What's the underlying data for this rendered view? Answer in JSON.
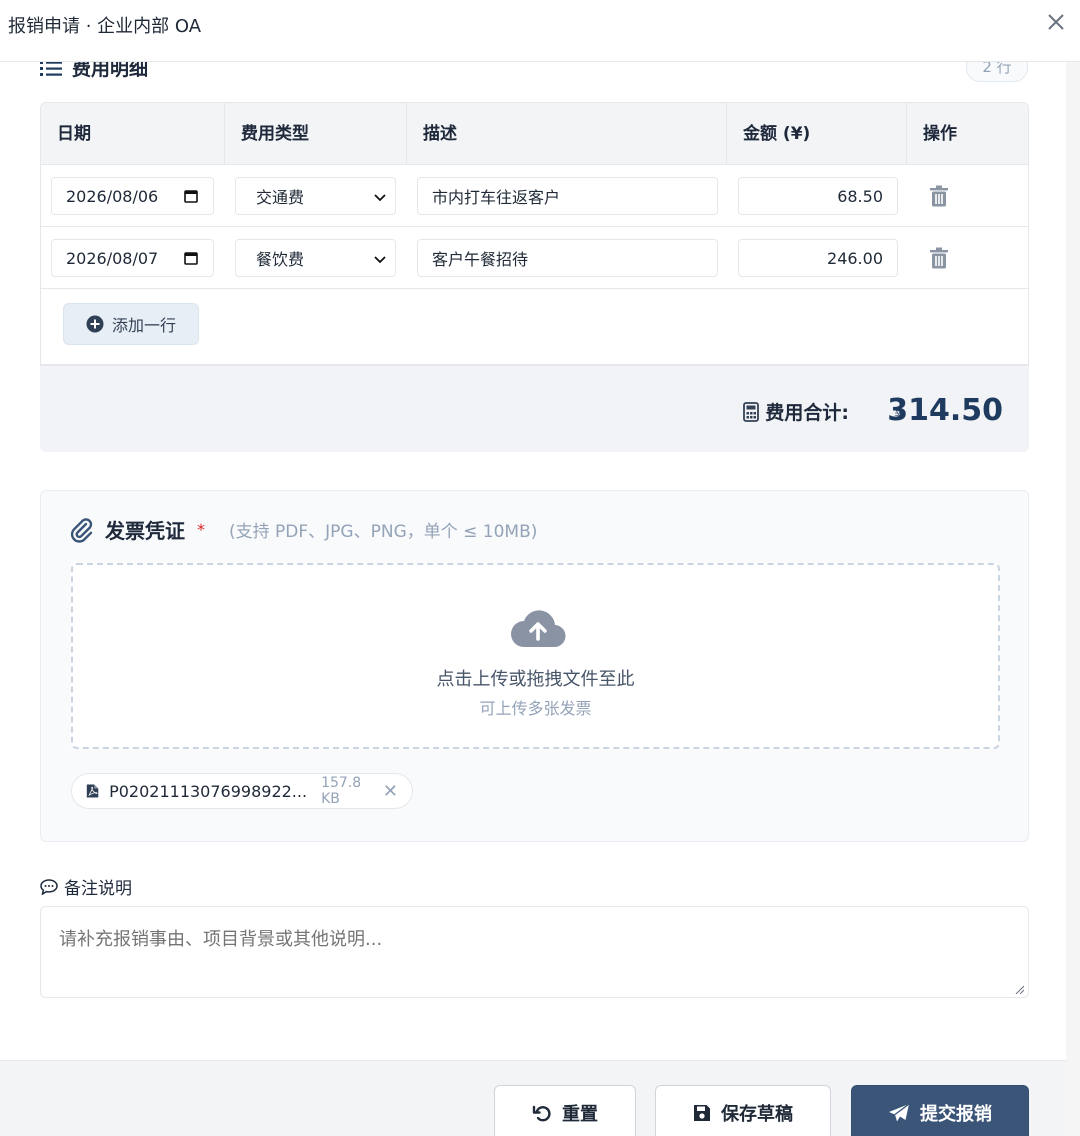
{
  "window": {
    "title": "报销申请 · 企业内部 OA"
  },
  "section": {
    "title": "费用明细",
    "row_count": "2 行"
  },
  "table": {
    "headers": [
      "日期",
      "费用类型",
      "描述",
      "金额 (¥)",
      "操作"
    ],
    "rows": [
      {
        "date": "2026/08/06",
        "type": "交通费",
        "desc": "市内打车往返客户",
        "amount": "68.50"
      },
      {
        "date": "2026/08/07",
        "type": "餐饮费",
        "desc": "客户午餐招待",
        "amount": "246.00"
      }
    ],
    "add_row_label": "添加一行"
  },
  "total": {
    "label": "费用合计:",
    "currency": "¥",
    "value": "314.50"
  },
  "invoice": {
    "title": "发票凭证",
    "required_mark": "*",
    "hint": "(支持 PDF、JPG、PNG，单个 ≤ 10MB)",
    "drop_main": "点击上传或拖拽文件至此",
    "drop_sub": "可上传多张发票",
    "file": {
      "name": "P02021113076998922...",
      "size": "157.8 KB",
      "remove": "✕"
    }
  },
  "remark": {
    "label": "备注说明",
    "placeholder": "请补充报销事由、项目背景或其他说明..."
  },
  "footer": {
    "reset_label": "重置",
    "draft_label": "保存草稿",
    "submit_label": "提交报销"
  },
  "colors": {
    "primary": "#3b5578",
    "required": "#dc2626",
    "muted": "#94a3b8"
  }
}
